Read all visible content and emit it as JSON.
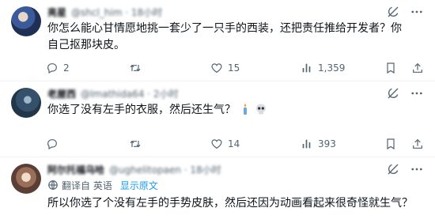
{
  "posts": [
    {
      "name": "亮星",
      "handle": "@shcl_him · 18小时",
      "text": "你怎么能心甘情愿地挑一套少了一只手的西装，还把责任推给开发者？你自己抠那块皮。",
      "stats": {
        "replies": "2",
        "retweets": "",
        "likes": "15",
        "views": "1,359"
      }
    },
    {
      "name": "老屋西",
      "handle": "@Imathida64 · 2小时",
      "text": "你选了没有左手的衣服，然后还生气？",
      "stats": {
        "replies": "",
        "retweets": "",
        "likes": "14",
        "views": "393"
      }
    },
    {
      "name": "阿尔托福乌哈",
      "handle": "@ughelitopaen · 18小时",
      "translation": {
        "label": "翻译自 英语",
        "show_original": "显示原文"
      },
      "text": "所以你选了个没有左手的手势皮肤，然后还因为动画看起来很奇怪就生气？"
    }
  ],
  "icons": {
    "more": "more-horizontal-icon",
    "grok": "grok-icon",
    "reply": "reply-icon",
    "retweet": "retweet-icon",
    "like": "heart-icon",
    "views": "bar-chart-icon",
    "bookmark": "bookmark-icon",
    "share": "share-icon",
    "translate": "globe-icon",
    "emoji1": "candle-emoji",
    "emoji2": "skull-emoji"
  },
  "colors": {
    "text": "#0f1419",
    "muted": "#536471",
    "link": "#1d9bf0",
    "divider": "#eff3f4"
  }
}
